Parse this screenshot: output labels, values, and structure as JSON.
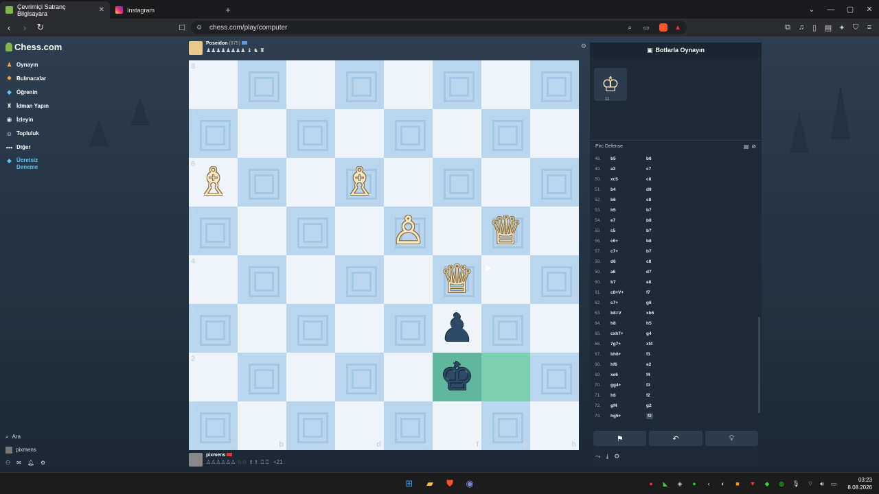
{
  "browser": {
    "tabs": [
      {
        "title": "Çevrimiçi Satranç Bilgisayara",
        "active": true
      },
      {
        "title": "Instagram",
        "active": false
      }
    ],
    "url": "chess.com/play/computer"
  },
  "sidebar": {
    "logo": "Chess.com",
    "items": [
      {
        "label": "Oynayın",
        "icon": "play-icon"
      },
      {
        "label": "Bulmacalar",
        "icon": "puzzle-icon"
      },
      {
        "label": "Öğrenin",
        "icon": "learn-icon"
      },
      {
        "label": "İdman Yapın",
        "icon": "train-icon"
      },
      {
        "label": "İzleyin",
        "icon": "watch-icon"
      },
      {
        "label": "Topluluk",
        "icon": "community-icon"
      },
      {
        "label": "Diğer",
        "icon": "more-icon"
      }
    ],
    "trial": "Ücretsiz Deneme",
    "search": "Ara",
    "user": "pixmens"
  },
  "top_player": {
    "name": "Poseidon",
    "rating": "(875)",
    "captured": "♟♟♟♟♟♟♟♟ ♝ ♞ ♜"
  },
  "bottom_player": {
    "name": "pixmens",
    "captured": "♙♙♙♙♙♙ ♘♘ ♗♗ ♖♖",
    "score": "+21"
  },
  "board": {
    "ranks": [
      "8",
      "7",
      "6",
      "5",
      "4",
      "3",
      "2",
      "1"
    ],
    "files": [
      "a",
      "b",
      "c",
      "d",
      "e",
      "f",
      "g",
      "h"
    ],
    "pieces": {
      "a6": {
        "glyph": "♗",
        "color": "w"
      },
      "d6": {
        "glyph": "♗",
        "color": "w"
      },
      "e5": {
        "glyph": "♙",
        "color": "w"
      },
      "g5": {
        "glyph": "♕",
        "color": "w"
      },
      "f4": {
        "glyph": "♕",
        "color": "w"
      },
      "f3": {
        "glyph": "♟",
        "color": "b"
      },
      "f2": {
        "glyph": "♚",
        "color": "b"
      }
    },
    "highlight": [
      "f2",
      "g2"
    ]
  },
  "panel": {
    "title": "Botlarla Oynayın",
    "bot_rating": "11",
    "opening": "Pirc Defense",
    "moves": [
      {
        "n": "48.",
        "w": "b5",
        "b": "b6"
      },
      {
        "n": "49.",
        "w": "a3",
        "b": "c7"
      },
      {
        "n": "50.",
        "w": "xc5",
        "b": "c8"
      },
      {
        "n": "51.",
        "w": "b4",
        "b": "d8"
      },
      {
        "n": "52.",
        "w": "b6",
        "b": "c8"
      },
      {
        "n": "53.",
        "w": "b5",
        "b": "b7"
      },
      {
        "n": "54.",
        "w": "e7",
        "b": "b8"
      },
      {
        "n": "55.",
        "w": "c5",
        "b": "b7"
      },
      {
        "n": "56.",
        "w": "c6+",
        "b": "b8"
      },
      {
        "n": "57.",
        "w": "c7+",
        "b": "b7"
      },
      {
        "n": "58.",
        "w": "d6",
        "b": "c8"
      },
      {
        "n": "59.",
        "w": "a6",
        "b": "d7"
      },
      {
        "n": "60.",
        "w": "b7",
        "b": "e8"
      },
      {
        "n": "61.",
        "w": "c8=V+",
        "b": "f7"
      },
      {
        "n": "62.",
        "w": "c7+",
        "b": "g6"
      },
      {
        "n": "63.",
        "w": "b8=V",
        "b": "xb6"
      },
      {
        "n": "64.",
        "w": "h8",
        "b": "h5"
      },
      {
        "n": "65.",
        "w": "cxh7+",
        "b": "g4"
      },
      {
        "n": "66.",
        "w": "7g7+",
        "b": "xf4"
      },
      {
        "n": "67.",
        "w": "bh6+",
        "b": "f3"
      },
      {
        "n": "68.",
        "w": "hf6",
        "b": "e2"
      },
      {
        "n": "69.",
        "w": "xe6",
        "b": "f4"
      },
      {
        "n": "70.",
        "w": "gg4+",
        "b": "f3"
      },
      {
        "n": "71.",
        "w": "h6",
        "b": "f2"
      },
      {
        "n": "72.",
        "w": "gf4",
        "b": "g2"
      },
      {
        "n": "73.",
        "w": "hg5+",
        "b": "f2"
      }
    ]
  },
  "taskbar": {
    "time": "03:23",
    "date": "8.08.2026"
  },
  "colors": {
    "accent": "#81b64c",
    "light_square": "#eef4f9",
    "dark_square": "#b9d6ee",
    "highlight": "#7ccfb0"
  }
}
